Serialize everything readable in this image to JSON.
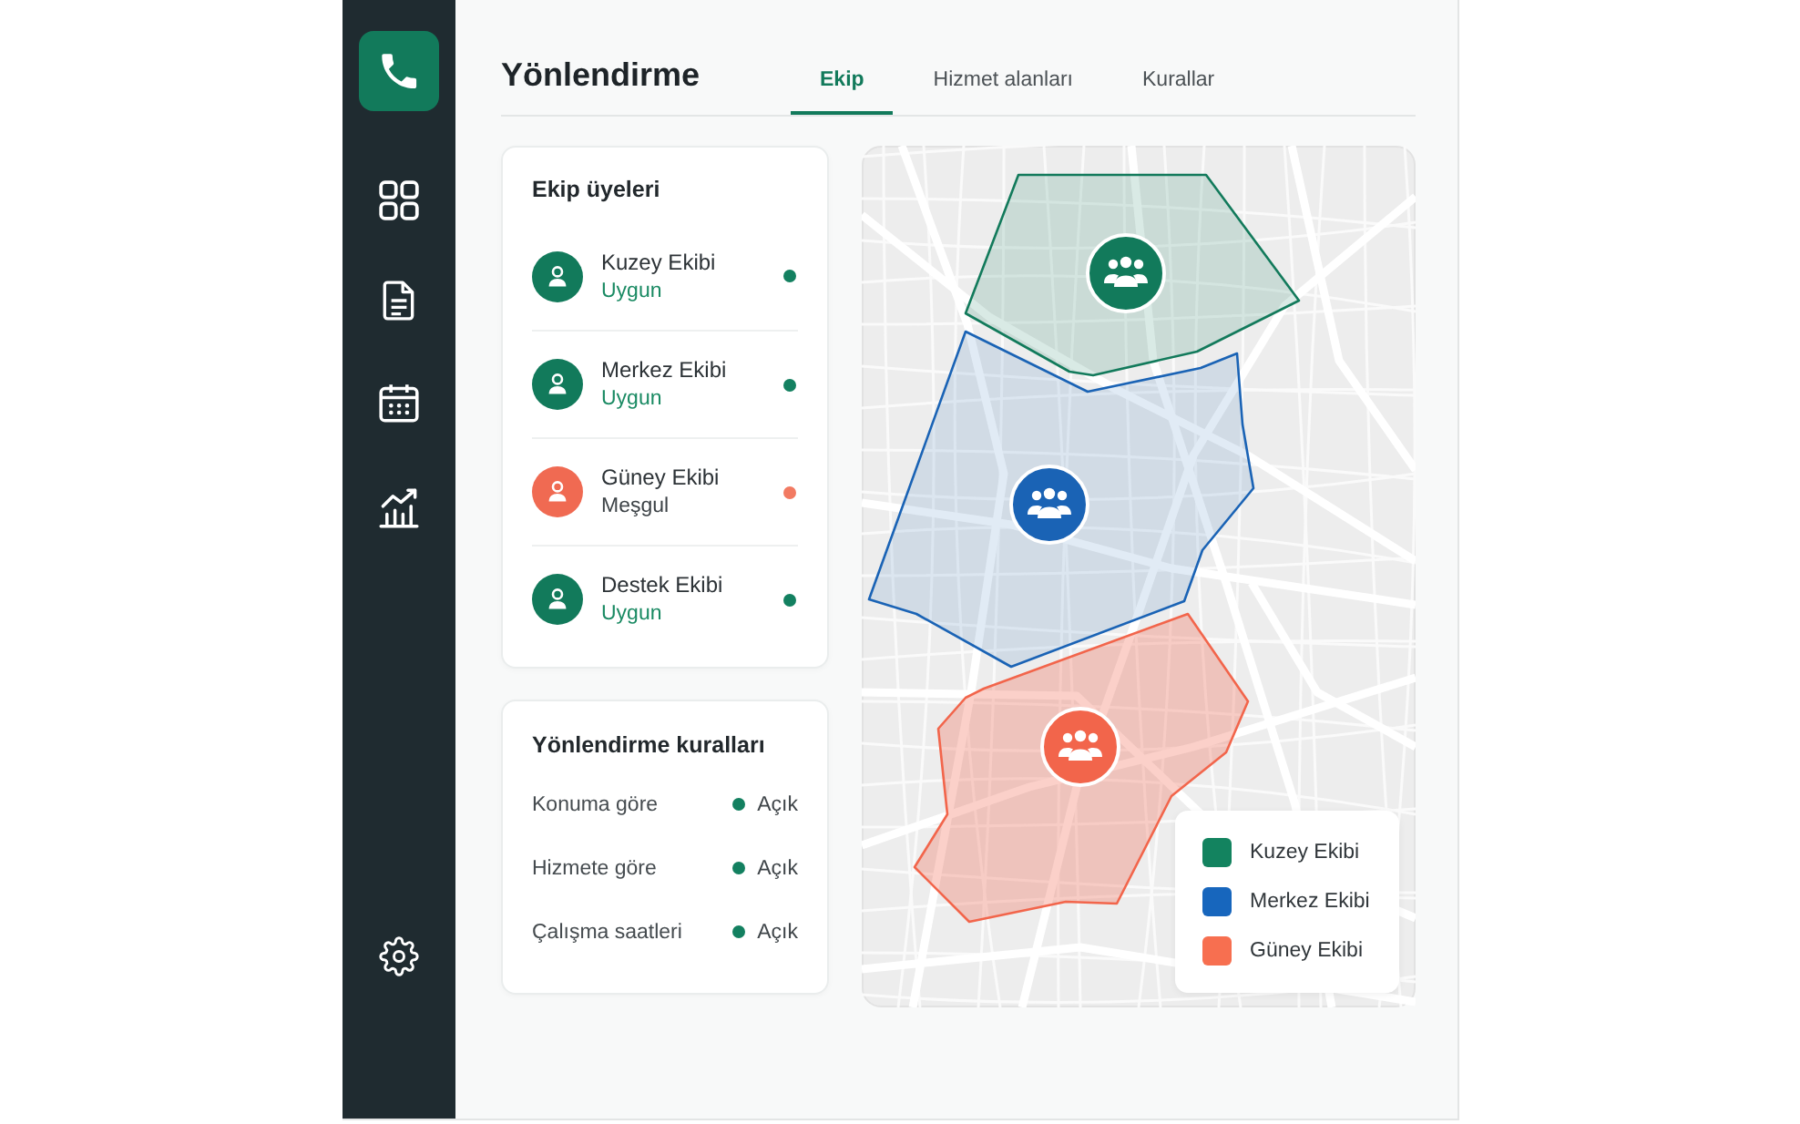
{
  "app": {
    "title": "Yönlendirme"
  },
  "tabs": [
    {
      "label": "Ekip",
      "selected": true
    },
    {
      "label": "Hizmet alanları",
      "selected": false
    },
    {
      "label": "Kurallar",
      "selected": false
    }
  ],
  "team_panel": {
    "title": "Ekip üyeleri",
    "members": [
      {
        "name": "Kuzey Ekibi",
        "status": "Uygun",
        "available": true
      },
      {
        "name": "Merkez Ekibi",
        "status": "Uygun",
        "available": true
      },
      {
        "name": "Güney Ekibi",
        "status": "Meşgul",
        "available": false
      },
      {
        "name": "Destek Ekibi",
        "status": "Uygun",
        "available": true
      }
    ]
  },
  "rules_panel": {
    "title": "Yönlendirme kuralları",
    "rules": [
      {
        "label": "Konuma göre",
        "value": "Açık",
        "on": true
      },
      {
        "label": "Hizmete göre",
        "value": "Açık",
        "on": true
      },
      {
        "label": "Çalışma saatleri",
        "value": "Açık",
        "on": true
      }
    ]
  },
  "map": {
    "zones": [
      {
        "color": "#127a5b"
      },
      {
        "color": "#1a63b5"
      },
      {
        "color": "#f2654b"
      }
    ],
    "legend": [
      {
        "label": "Kuzey Ekibi",
        "color": "#13835f"
      },
      {
        "label": "Merkez Ekibi",
        "color": "#1766bd"
      },
      {
        "label": "Güney Ekibi",
        "color": "#f76f50"
      }
    ]
  }
}
